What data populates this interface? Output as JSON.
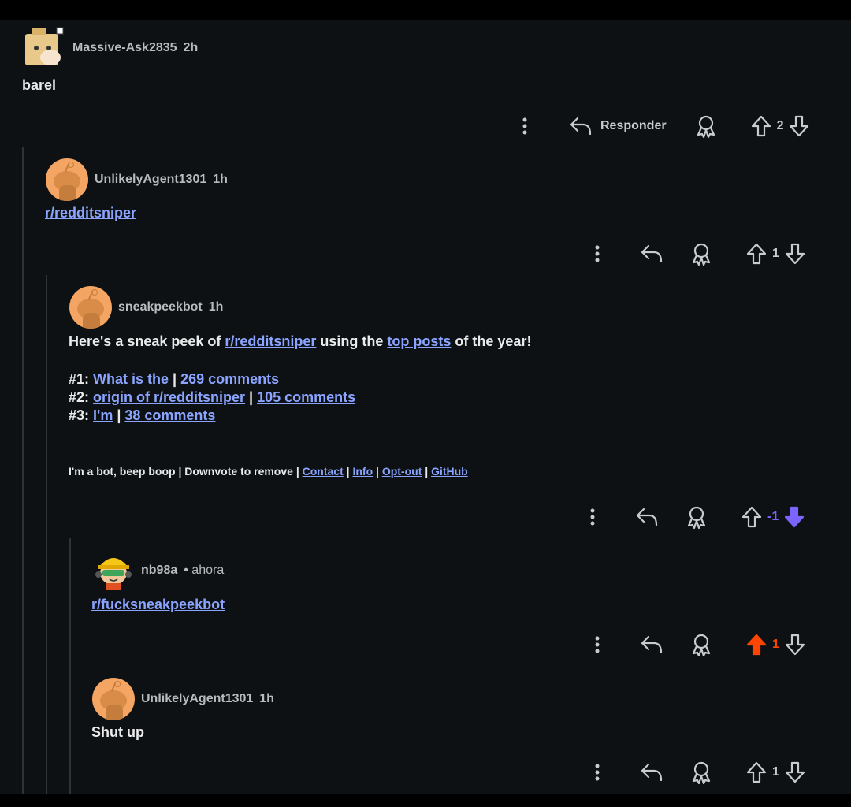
{
  "comments": {
    "c1": {
      "user": "Massive-Ask2835",
      "time": "2h",
      "body": "barel",
      "reply_label": "Responder",
      "score": "2"
    },
    "c2": {
      "user": "UnlikelyAgent1301",
      "time": "1h",
      "body_link": "r/redditsniper",
      "score": "1"
    },
    "c3": {
      "user": "sneakpeekbot",
      "time": "1h",
      "intro_1": "Here's a sneak peek of ",
      "intro_link": "r/redditsniper",
      "intro_2": " using the ",
      "intro_link2": "top posts",
      "intro_3": " of the year!",
      "items": [
        {
          "num": "#1:",
          "title": "What is the",
          "sep": " | ",
          "comments": "269 comments"
        },
        {
          "num": "#2:",
          "title": "origin of r/redditsniper",
          "sep": " | ",
          "comments": "105 comments"
        },
        {
          "num": "#3:",
          "title": "I'm",
          "sep": " | ",
          "comments": "38 comments"
        }
      ],
      "footer_text": "I'm a bot, beep boop | Downvote to remove | ",
      "footer_links": [
        "Contact",
        "Info",
        "Opt-out",
        "GitHub"
      ],
      "footer_sep": " | ",
      "score": "-1"
    },
    "c4": {
      "user": "nb98a",
      "time": "• ahora",
      "body_link": "r/fucksneakpeekbot",
      "score": "1"
    },
    "c5": {
      "user": "UnlikelyAgent1301",
      "time": "1h",
      "body": "Shut up",
      "score": "1"
    }
  },
  "colors": {
    "upvoted": "#ff4500",
    "downvoted": "#7c64ff",
    "link": "#8aa4ff",
    "background": "#0e1113"
  },
  "icons": [
    "more-vertical-icon",
    "reply-icon",
    "award-icon",
    "upvote-icon",
    "downvote-icon"
  ]
}
